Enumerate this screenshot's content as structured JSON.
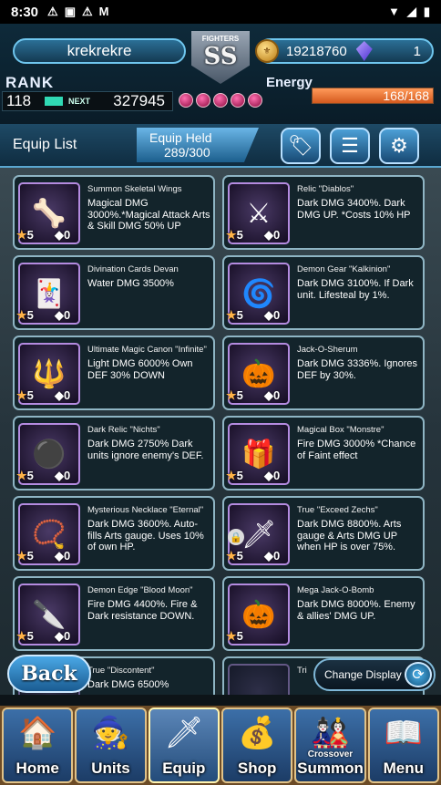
{
  "status_bar": {
    "time": "8:30",
    "left_icons": [
      "warning-icon",
      "app-icon",
      "warning-icon",
      "gmail-icon"
    ],
    "right_icons": [
      "wifi-icon",
      "signal-icon",
      "battery-icon"
    ]
  },
  "player": {
    "name": "krekrekre",
    "gold": "19218760",
    "gems": "1",
    "fighters_label": "FIGHTERS",
    "rank_grade": "SS"
  },
  "rank": {
    "label": "RANK",
    "value": "118",
    "next_label": "NEXT",
    "next_value": "327945"
  },
  "energy": {
    "label": "Energy",
    "text": "168/168",
    "fill_fraction": 1.0
  },
  "toolbar": {
    "list_label": "Equip List",
    "held_label": "Equip Held",
    "held_value": "289/300",
    "buttons": [
      "tag-icon",
      "sort-icon",
      "settings-icon"
    ]
  },
  "equipment": [
    {
      "name": "Summon Skeletal Wings",
      "desc": "Magical DMG 3000%.*Magical Attack Arts & Skill DMG 50% UP",
      "rarity": "5",
      "sockets": "0",
      "icon": "🦴",
      "locked": false
    },
    {
      "name": "Relic \"Diablos\"",
      "desc": "Dark DMG 3400%. Dark DMG UP. *Costs 10% HP",
      "rarity": "5",
      "sockets": "0",
      "icon": "⚔",
      "locked": false
    },
    {
      "name": "Divination Cards Devan",
      "desc": "Water DMG 3500%",
      "rarity": "5",
      "sockets": "0",
      "icon": "🃏",
      "locked": false
    },
    {
      "name": "Demon Gear \"Kalkinion\"",
      "desc": "Dark DMG 3100%. If Dark unit. Lifesteal by 1%.",
      "rarity": "5",
      "sockets": "0",
      "icon": "🌀",
      "locked": false
    },
    {
      "name": "Ultimate Magic Canon \"Infinite\"",
      "desc": "Light DMG 6000% Own DEF 30% DOWN",
      "rarity": "5",
      "sockets": "0",
      "icon": "🔱",
      "locked": false
    },
    {
      "name": "Jack-O-Sherum",
      "desc": "Dark DMG 3336%. Ignores DEF by 30%.",
      "rarity": "5",
      "sockets": "0",
      "icon": "🎃",
      "locked": false
    },
    {
      "name": "Dark Relic \"Nichts\"",
      "desc": "Dark DMG 2750% Dark units ignore enemy's DEF.",
      "rarity": "5",
      "sockets": "0",
      "icon": "⚫",
      "locked": false
    },
    {
      "name": "Magical Box \"Monstre\"",
      "desc": "Fire DMG 3000% *Chance of Faint effect",
      "rarity": "5",
      "sockets": "0",
      "icon": "🎁",
      "locked": false
    },
    {
      "name": "Mysterious Necklace \"Eternal\"",
      "desc": "Dark DMG 3600%. Auto-fills Arts gauge. Uses 10% of own HP.",
      "rarity": "5",
      "sockets": "0",
      "icon": "📿",
      "locked": false
    },
    {
      "name": "True \"Exceed Zechs\"",
      "desc": "Dark DMG 8800%. Arts gauge & Arts DMG UP when HP is over 75%.",
      "rarity": "5",
      "sockets": "0",
      "icon": "🗡",
      "locked": true
    },
    {
      "name": "Demon Edge \"Blood Moon\"",
      "desc": "Fire DMG 4400%. Fire & Dark resistance DOWN.",
      "rarity": "5",
      "sockets": "0",
      "icon": "🔪",
      "locked": false
    },
    {
      "name": "Mega Jack-O-Bomb",
      "desc": "Dark DMG 8000%. Enemy & allies' DMG UP.",
      "rarity": "5",
      "sockets": "",
      "icon": "🎃",
      "locked": false
    },
    {
      "name": "True \"Discontent\"",
      "desc": "Dark DMG 6500%",
      "rarity": "",
      "sockets": "",
      "icon": "",
      "locked": false
    },
    {
      "name": "Tri",
      "desc": "",
      "rarity": "",
      "sockets": "",
      "icon": "",
      "locked": false
    }
  ],
  "buttons": {
    "back": "Back",
    "change_display": "Change Display"
  },
  "nav": [
    {
      "label": "Home",
      "sub": "",
      "icon": "🏠",
      "icon_name": "house-icon"
    },
    {
      "label": "Units",
      "sub": "",
      "icon": "🧙",
      "icon_name": "units-icon"
    },
    {
      "label": "Equip",
      "sub": "",
      "icon": "🗡",
      "icon_name": "sword-icon"
    },
    {
      "label": "Shop",
      "sub": "",
      "icon": "💰",
      "icon_name": "treasure-icon"
    },
    {
      "label": "Summon",
      "sub": "Crossover",
      "icon": "🎎",
      "icon_name": "summon-icon"
    },
    {
      "label": "Menu",
      "sub": "",
      "icon": "📖",
      "icon_name": "book-icon"
    }
  ]
}
